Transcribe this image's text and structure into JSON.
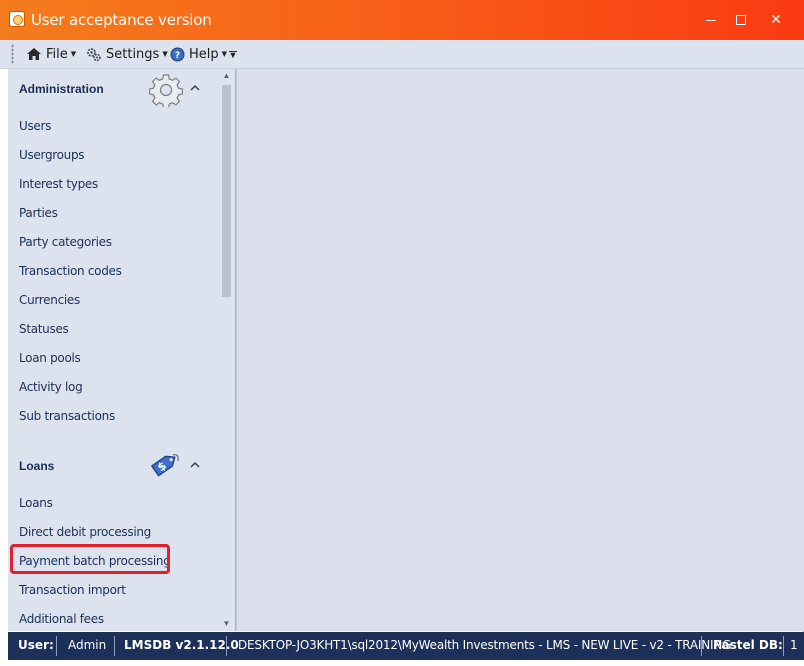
{
  "window": {
    "title": "User acceptance version",
    "minimize_label": "",
    "maximize_label": "",
    "close_label": "✕"
  },
  "menu": {
    "file": "File",
    "settings": "Settings",
    "help": "Help"
  },
  "sidebar": {
    "administration": {
      "title": "Administration",
      "icon": "gear-icon",
      "items": [
        {
          "label": "Users"
        },
        {
          "label": "Usergroups"
        },
        {
          "label": "Interest types"
        },
        {
          "label": "Parties"
        },
        {
          "label": "Party categories"
        },
        {
          "label": "Transaction codes"
        },
        {
          "label": "Currencies"
        },
        {
          "label": "Statuses"
        },
        {
          "label": "Loan pools"
        },
        {
          "label": "Activity log"
        },
        {
          "label": "Sub transactions"
        }
      ]
    },
    "loans": {
      "title": "Loans",
      "icon": "price-tag-icon",
      "items": [
        {
          "label": "Loans"
        },
        {
          "label": "Direct debit processing"
        },
        {
          "label": "Payment batch processing",
          "highlighted": true
        },
        {
          "label": "Transaction import"
        },
        {
          "label": "Additional fees"
        }
      ]
    }
  },
  "statusbar": {
    "user_label": "User:",
    "user_value": "Admin",
    "version": "LMSDB v2.1.12.0",
    "connection": "DESKTOP-JO3KHT1\\sql2012\\MyWealth Investments - LMS - NEW LIVE - v2 - TRAINING",
    "pastel_label": "Pastel DB:",
    "pastel_value": "1"
  },
  "colors": {
    "titlebar_start": "#f47c1c",
    "titlebar_end": "#fb3a12",
    "sidebar_bg": "#dde3ee",
    "statusbar_bg": "#1c3059",
    "highlight": "#e0202a"
  }
}
